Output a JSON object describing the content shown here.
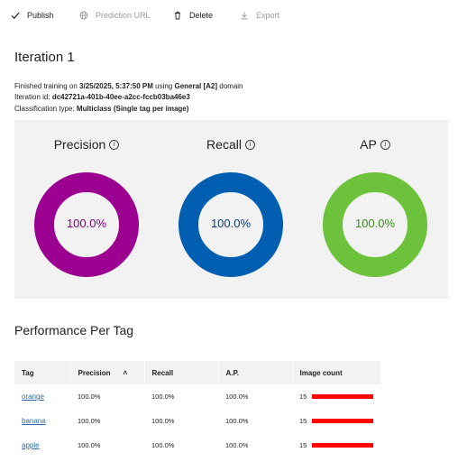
{
  "toolbar": {
    "publish_label": "Publish",
    "prediction_url_label": "Prediction URL",
    "delete_label": "Delete",
    "export_label": "Export"
  },
  "page_title": "Iteration 1",
  "info": {
    "line1_prefix": "Finished training on ",
    "line1_datetime": "3/25/2025, 5:37:50 PM",
    "line1_mid": " using ",
    "line1_domain": "General [A2]",
    "line1_suffix": " domain",
    "line2_prefix": "Iteration id: ",
    "line2_id": "dc42721a-401b-40ee-a2cc-fccb03ba46e3",
    "line3_prefix": "Classification type: ",
    "line3_type": "Multiclass (Single tag per image)"
  },
  "metrics": [
    {
      "label": "Precision",
      "value": "100.0%",
      "fraction": 1.0,
      "color": "#9b0090",
      "text_color": "#7a0072"
    },
    {
      "label": "Recall",
      "value": "100.0%",
      "fraction": 1.0,
      "color": "#005eb0",
      "text_color": "#0b3a78"
    },
    {
      "label": "AP",
      "value": "100.0%",
      "fraction": 1.0,
      "color": "#6cc23a",
      "text_color": "#3c8b1e"
    }
  ],
  "section_title": "Performance Per Tag",
  "table": {
    "headers": {
      "tag": "Tag",
      "precision": "Precision",
      "recall": "Recall",
      "ap": "A.P.",
      "image_count": "Image count"
    },
    "rows": [
      {
        "tag": "orange",
        "precision": "100.0%",
        "recall": "100.0%",
        "ap": "100.0%",
        "count": "15",
        "count_fraction": 1.0
      },
      {
        "tag": "banana",
        "precision": "100.0%",
        "recall": "100.0%",
        "ap": "100.0%",
        "count": "15",
        "count_fraction": 1.0
      },
      {
        "tag": "apple",
        "precision": "100.0%",
        "recall": "100.0%",
        "ap": "100.0%",
        "count": "15",
        "count_fraction": 1.0
      }
    ]
  },
  "icons": {
    "publish": "check-icon",
    "prediction_url": "globe-icon",
    "delete": "trash-icon",
    "export": "download-icon",
    "info": "info-icon",
    "sort": "sort-ascending-icon"
  }
}
